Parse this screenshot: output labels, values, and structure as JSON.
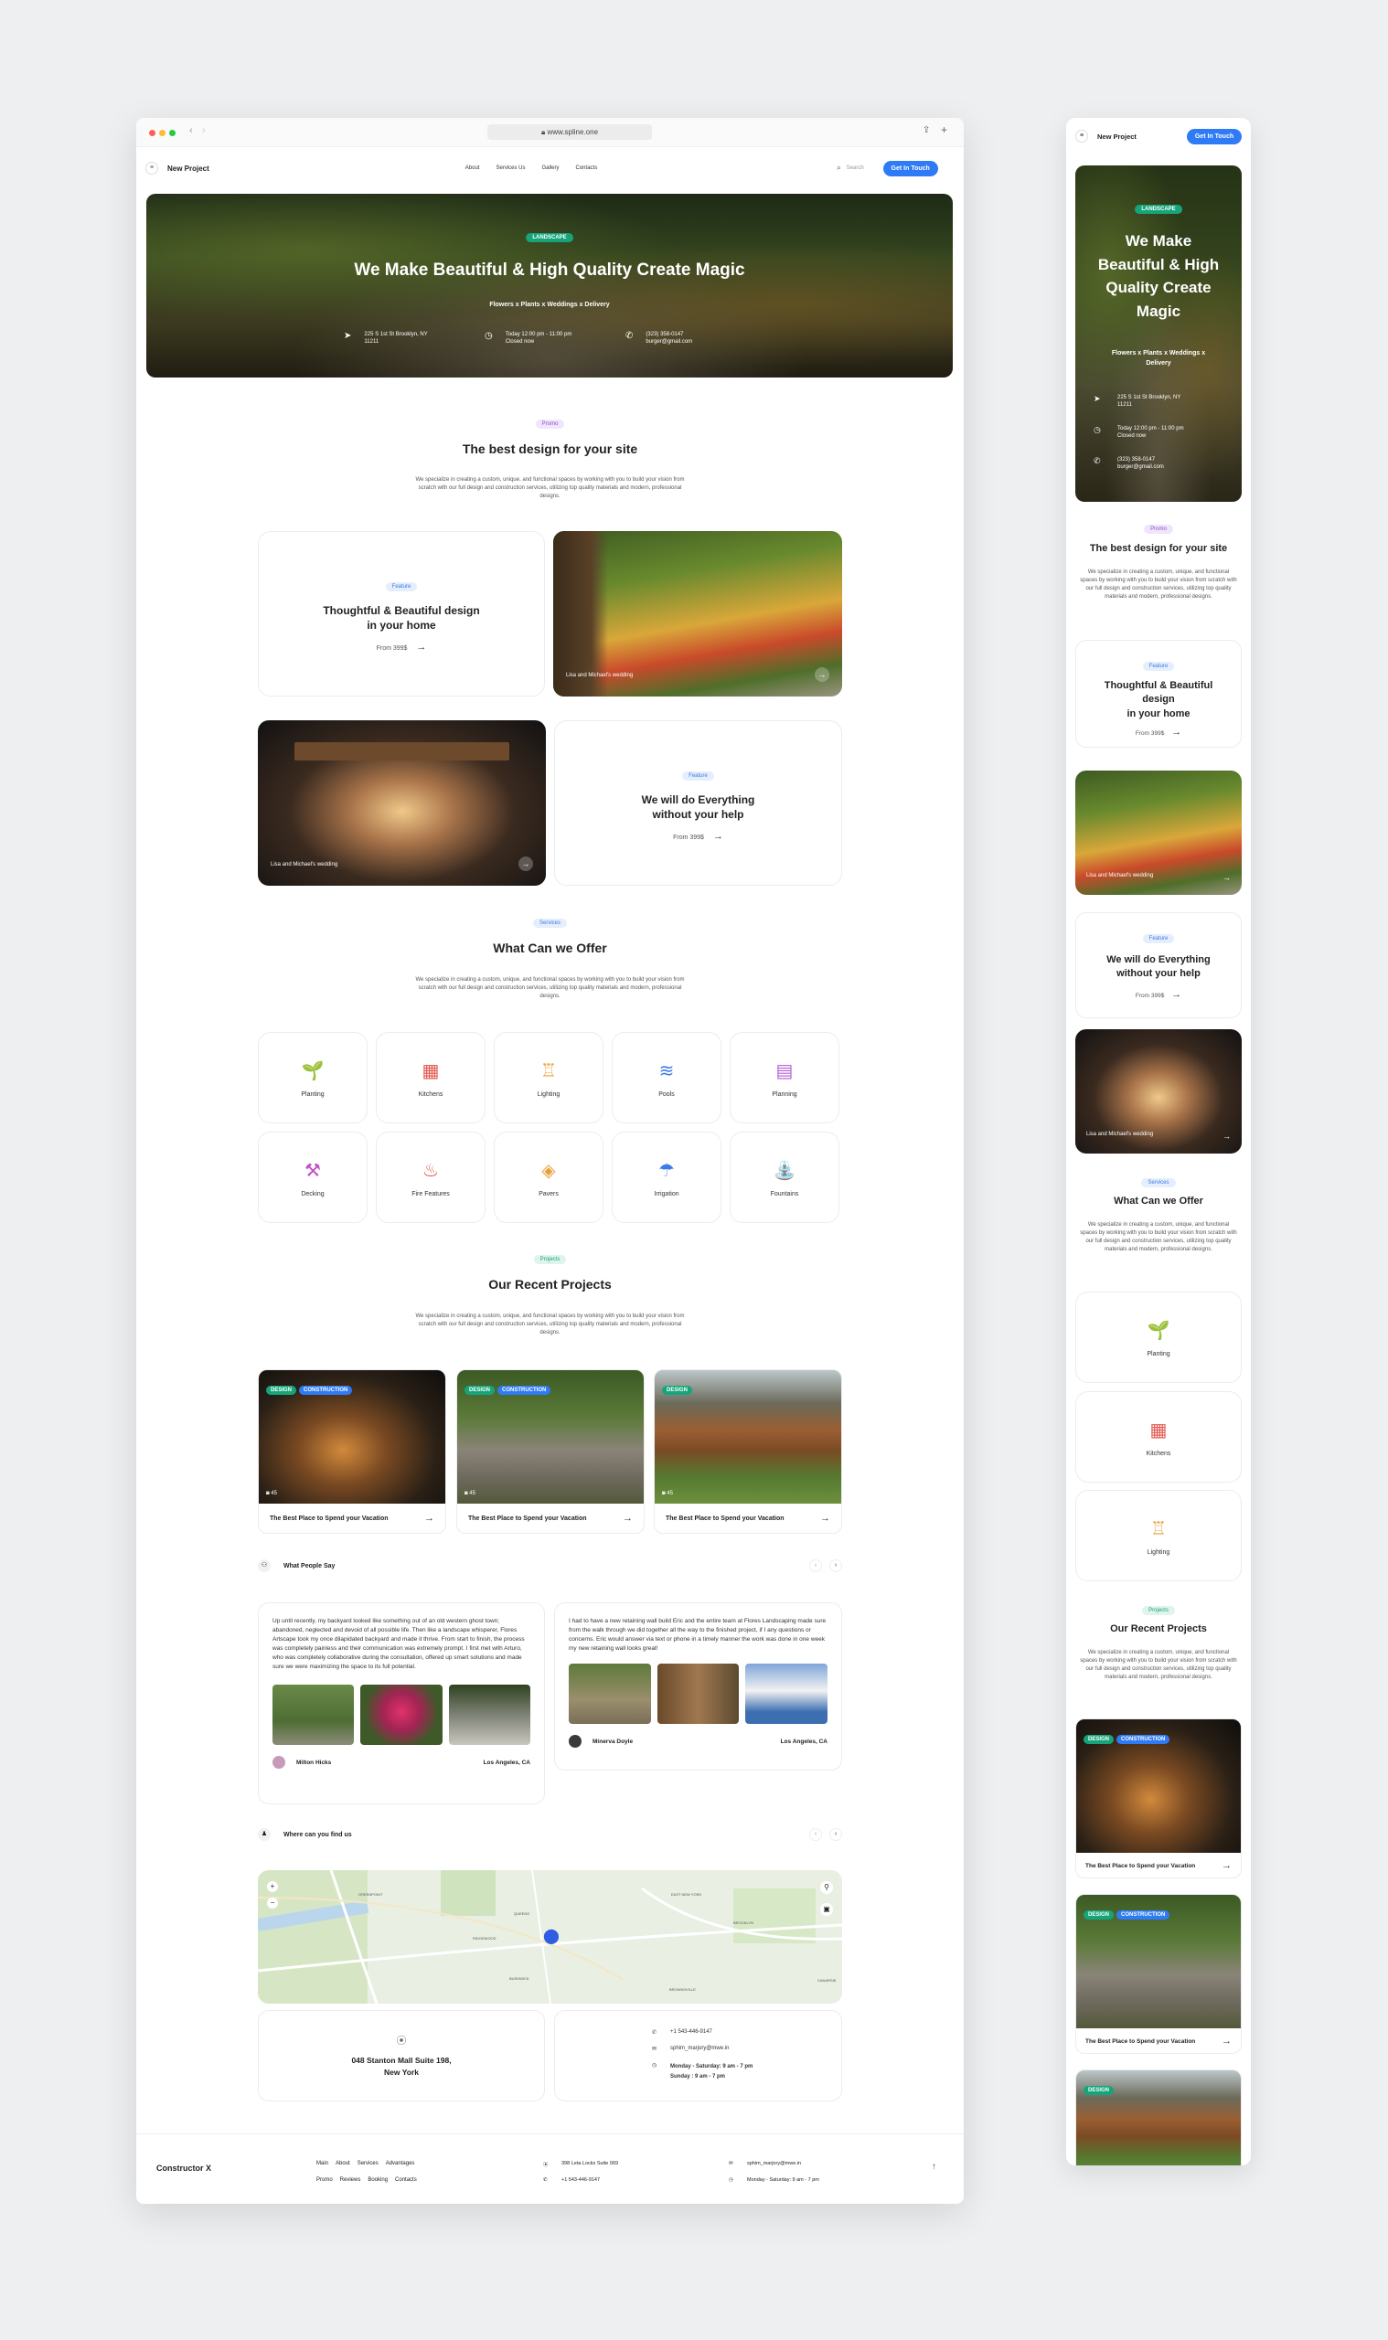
{
  "browser": {
    "url": "www.spline.one"
  },
  "nav": {
    "brand": "New Project",
    "links": [
      "About",
      "Services Us",
      "Gallery",
      "Contacts"
    ],
    "search_placeholder": "Search",
    "cta": "Get In Touch"
  },
  "hero": {
    "badge": "LANDSCAPE",
    "title": "We Make Beautiful & High Quality Create Magic",
    "subtitle": "Flowers x Plants x Weddings x Delivery",
    "address": "225 S 1st St Brooklyn, NY 11211",
    "hours": "Today 12:00 pm - 11:00 pm",
    "hours_note": "Closed now",
    "phone": "(323) 358-0147",
    "email": "burger@gmail.com"
  },
  "intro": {
    "badge": "Promo",
    "title": "The best design for your site",
    "desc": "We specialize in creating a custom, unique, and functional spaces by working with you to build your vision from scratch with our full design and construction services, utilizing top quality materials and modern, professional designs."
  },
  "features": [
    {
      "badge": "Feature",
      "title_1": "Thoughtful & Beautiful design",
      "title_2": "in your home",
      "price": "From 399$",
      "photo_caption": "Lisa and Michael's wedding"
    },
    {
      "badge": "Feature",
      "title_1": "We will do Everything",
      "title_2": "without your help",
      "price": "From 399$",
      "photo_caption": "Lisa and Michael's wedding"
    }
  ],
  "services": {
    "badge": "Services",
    "title": "What Can we Offer",
    "desc": "We specialize in creating a custom, unique, and functional spaces by working with you to build your vision from scratch with our full design and construction services, utilizing top quality materials and modern, professional designs.",
    "items": [
      {
        "label": "Planting",
        "icon": "sprout-icon",
        "glyph": "🌱",
        "color": "#2fae6c"
      },
      {
        "label": "Kitchens",
        "icon": "stove-icon",
        "glyph": "▦",
        "color": "#e2554b"
      },
      {
        "label": "Lighting",
        "icon": "lamp-icon",
        "glyph": "♖",
        "color": "#e8a23b"
      },
      {
        "label": "Pools",
        "icon": "pool-icon",
        "glyph": "≋",
        "color": "#3e7be8"
      },
      {
        "label": "Planning",
        "icon": "blueprint-icon",
        "glyph": "▤",
        "color": "#b65bd6"
      },
      {
        "label": "Decking",
        "icon": "hammer-icon",
        "glyph": "⚒",
        "color": "#c44fc9"
      },
      {
        "label": "Fire Features",
        "icon": "fire-icon",
        "glyph": "♨",
        "color": "#e2554b"
      },
      {
        "label": "Pavers",
        "icon": "pavers-icon",
        "glyph": "◈",
        "color": "#e8a23b"
      },
      {
        "label": "Irrigation",
        "icon": "irrigation-icon",
        "glyph": "☂",
        "color": "#3e7be8"
      },
      {
        "label": "Fountains",
        "icon": "fountain-icon",
        "glyph": "⛲",
        "color": "#2a9fc5"
      }
    ]
  },
  "projects": {
    "badge": "Projects",
    "title": "Our Recent Projects",
    "desc": "We specialize in creating a custom, unique, and functional spaces by working with you to build your vision from scratch with our full design and construction services, utilizing top quality materials and modern, professional designs.",
    "items": [
      {
        "title": "The Best Place to Spend your Vacation",
        "tags": [
          "DESIGN",
          "CONSTRUCTION"
        ],
        "count": "45"
      },
      {
        "title": "The Best Place to Spend your Vacation",
        "tags": [
          "DESIGN",
          "CONSTRUCTION"
        ],
        "count": "45"
      },
      {
        "title": "The Best Place to Spend your Vacation",
        "tags": [
          "DESIGN"
        ],
        "count": "45"
      }
    ]
  },
  "reviews": {
    "title": "What People Say",
    "items": [
      {
        "text": "Up until recently, my backyard looked like something out of an old western ghost town; abandoned, neglected and devoid of all possible life. Then like a landscape whisperer, Flores Artscape took my once dilapidated backyard and made it thrive. From start to finish, the process was completely painless and their communication was extremely prompt. I first met with Arturo, who was completely collaborative during the consultation, offered up smart solutions and made sure we were maximizing the space to its full potential.",
        "name": "Milton Hicks",
        "location": "Los Angeles, CA"
      },
      {
        "text": "I had to have a new retaining wall build Eric and the entire team at Flores Landscaping made sure from the walk through we did together all the way to the finished project, if I any questions or concerns. Eric would answer via text or phone in a timely manner the work was done in one week my new retaining wall looks great!",
        "name": "Minerva Doyle",
        "location": "Los Angeles, CA"
      }
    ]
  },
  "location": {
    "title": "Where can you find us",
    "address_1": "048 Stanton Mall Suite 198,",
    "address_2": "New York",
    "phone": "+1 543-446-9147",
    "email": "sphim_marjory@mwe.in",
    "hours_1": "Monday - Saturday: 9 am - 7 pm",
    "hours_2": "Sunday : 9 am - 7 pm",
    "map_labels": [
      "EAST NEW YORK",
      "BROOKLYN",
      "QUEENS",
      "BROWNSVILLE",
      "CANARSIE",
      "RIDGEWOOD",
      "BUSHWICK",
      "GREENPOINT"
    ]
  },
  "footer": {
    "brand": "Constructor X",
    "links_row_1": [
      "Main",
      "About",
      "Services",
      "Advantages"
    ],
    "links_row_2": [
      "Promo",
      "Reviews",
      "Booking",
      "Contacts"
    ],
    "address": "398 Leta Locks Suite 069",
    "phone": "+1 543-446-9147",
    "email": "sphim_marjory@mwe.in",
    "hours": "Monday - Saturday: 9 am - 7 pm"
  },
  "mobile": {
    "hero_title_lines": [
      "We Make",
      "Beautiful & High",
      "Quality Create",
      "Magic"
    ],
    "hero_subtitle": "Flowers x Plants x Weddings x",
    "hero_subtitle_2": "Delivery",
    "hours": "Today 12:00 pm - 11:00 pm",
    "feature_1_lines": [
      "Thoughtful & Beautiful",
      "design",
      "in your home"
    ]
  }
}
